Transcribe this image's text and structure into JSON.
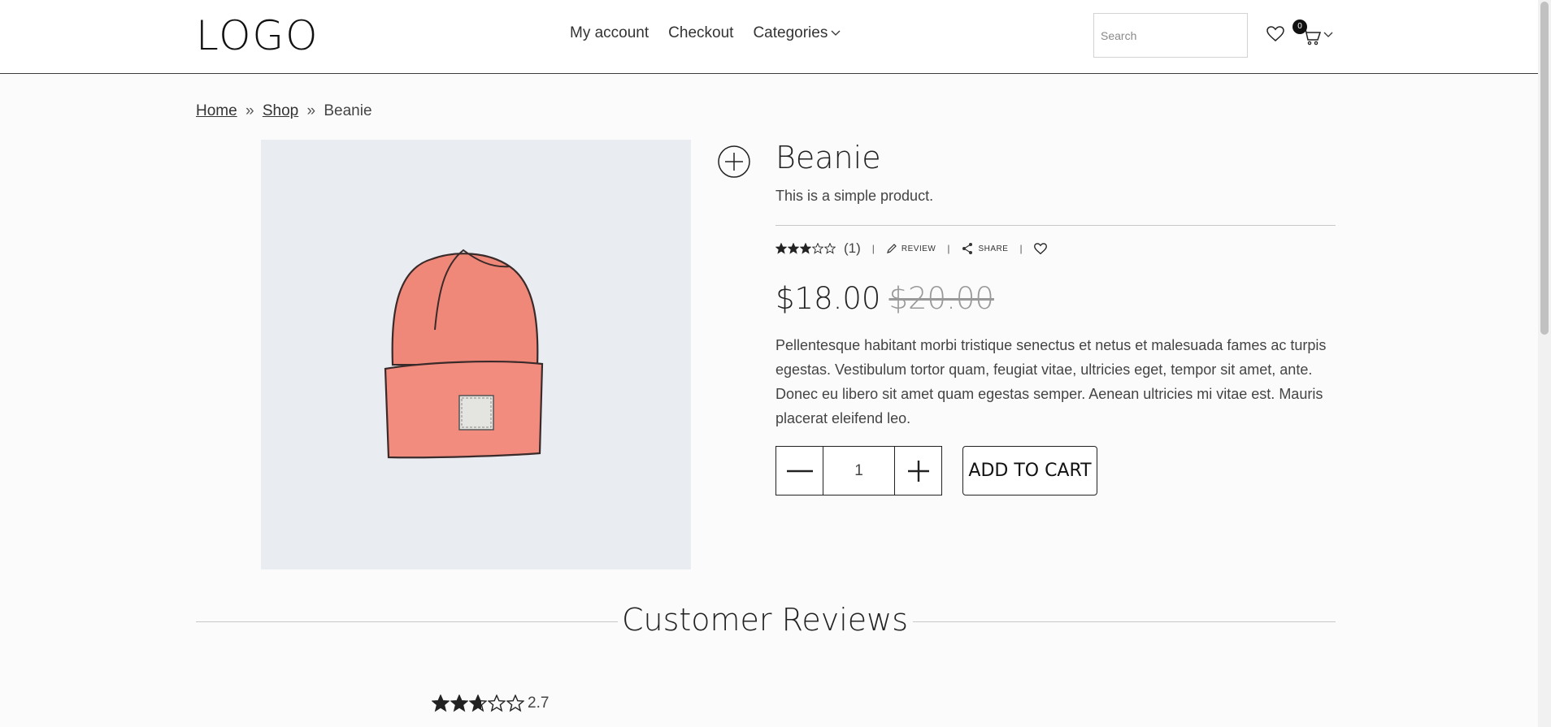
{
  "header": {
    "logo": "LOGO",
    "nav": [
      {
        "label": "My account"
      },
      {
        "label": "Checkout"
      },
      {
        "label": "Categories"
      }
    ],
    "search_placeholder": "Search",
    "cart_count": "0"
  },
  "breadcrumb": {
    "home": "Home",
    "shop": "Shop",
    "current": "Beanie",
    "separator": "»"
  },
  "product": {
    "title": "Beanie",
    "short_description": "This is a simple product.",
    "rating": 3,
    "rating_count": "(1)",
    "review_label": "REVIEW",
    "share_label": "SHARE",
    "price_now": "$18.00",
    "price_old": "$20.00",
    "description": "Pellentesque habitant morbi tristique senectus et netus et malesuada fames ac turpis egestas. Vestibulum tortor quam, feugiat vitae, ultricies eget, tempor sit amet, ante. Donec eu libero sit amet quam egestas semper. Aenean ultricies mi vitae est. Mauris placerat eleifend leo.",
    "quantity": "1",
    "add_to_cart": "ADD TO CART",
    "image_icon": "beanie-illustration",
    "image_colors": {
      "beanie": "#f0887a",
      "background": "#e9ecf1"
    }
  },
  "reviews": {
    "title": "Customer Reviews",
    "average": "2.7",
    "average_rating": 2.7
  },
  "colors": {
    "accent": "#222222",
    "border": "#c8c8c8"
  }
}
